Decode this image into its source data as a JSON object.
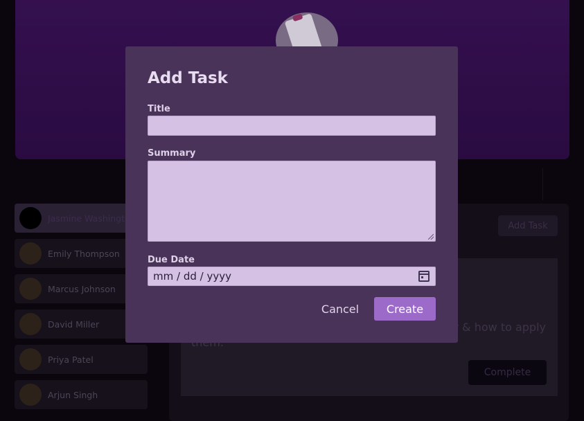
{
  "background": {
    "users": [
      {
        "name": "Jasmine Washington",
        "active": true
      },
      {
        "name": "Emily Thompson"
      },
      {
        "name": "Marcus Johnson"
      },
      {
        "name": "David Miller"
      },
      {
        "name": "Priya Patel"
      },
      {
        "name": "Arjun Singh"
      }
    ],
    "add_task_label": "Add Task",
    "task_desc_line1": "er & how to apply",
    "task_desc_line2": "them.",
    "complete_label": "Complete"
  },
  "modal": {
    "title": "Add Task",
    "title_label": "Title",
    "title_value": "",
    "summary_label": "Summary",
    "summary_value": "",
    "due_label": "Due Date",
    "due_placeholder": "mm / dd / yyyy",
    "cancel_label": "Cancel",
    "create_label": "Create"
  },
  "colors": {
    "modal_bg": "#4a3358",
    "input_bg": "#d4c1e4",
    "primary": "#9c6bc9"
  }
}
